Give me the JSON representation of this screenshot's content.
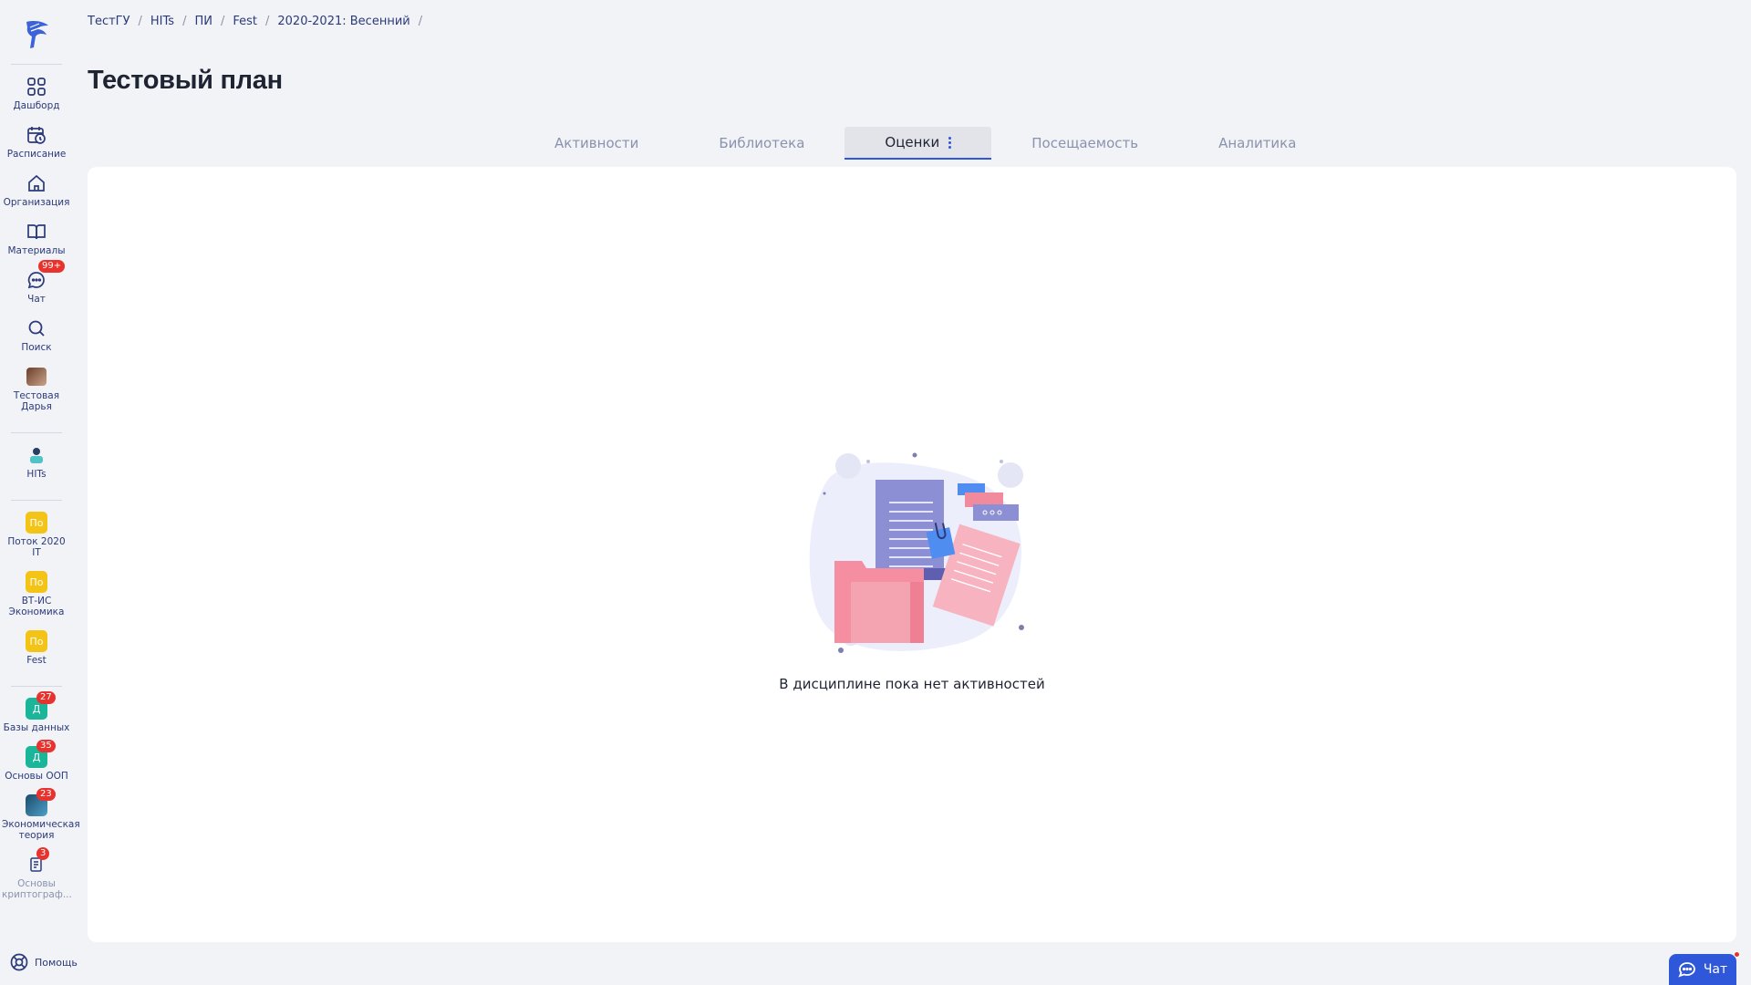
{
  "breadcrumb": [
    "ТестГУ",
    "HITs",
    "ПИ",
    "Fest",
    "2020-2021: Весенний"
  ],
  "breadcrumb_separator": "/",
  "page_title": "Тестовый план",
  "tabs": [
    {
      "label": "Активности",
      "active": false
    },
    {
      "label": "Библиотека",
      "active": false
    },
    {
      "label": "Оценки",
      "active": true
    },
    {
      "label": "Посещаемость",
      "active": false
    },
    {
      "label": "Аналитика",
      "active": false
    }
  ],
  "sidebar": {
    "items": [
      {
        "label": "Дашборд",
        "icon": "grid-icon"
      },
      {
        "label": "Расписание",
        "icon": "calendar-clock-icon"
      },
      {
        "label": "Организация",
        "icon": "home-icon"
      },
      {
        "label": "Материалы",
        "icon": "book-icon"
      },
      {
        "label": "Чат",
        "icon": "chat-icon",
        "badge": "99+"
      },
      {
        "label": "Поиск",
        "icon": "search-icon"
      },
      {
        "label": "Тестовая Дарья",
        "icon": "user-avatar"
      }
    ],
    "org": {
      "label": "HITs",
      "icon": "org-avatar"
    },
    "groups": [
      {
        "label": "Поток 2020 IT",
        "short": "По"
      },
      {
        "label": "ВТ-ИС Экономика",
        "short": "По"
      },
      {
        "label": "Fest",
        "short": "По"
      }
    ],
    "courses": [
      {
        "label": "Базы данных",
        "short": "Д",
        "badge": "27"
      },
      {
        "label": "Основы ООП",
        "short": "Д",
        "badge": "35"
      },
      {
        "label": "Экономическая теория",
        "badge": "23"
      },
      {
        "label": "Основы криптограф...",
        "badge": "3"
      }
    ],
    "help_label": "Помощь"
  },
  "empty_state": {
    "text": "В дисциплине пока нет активностей"
  },
  "chat_button": {
    "label": "Чат"
  },
  "colors": {
    "accent": "#2f57d9",
    "badge": "#e8322d",
    "background": "#f2f3f7",
    "nav_text": "#2b3a7a"
  }
}
